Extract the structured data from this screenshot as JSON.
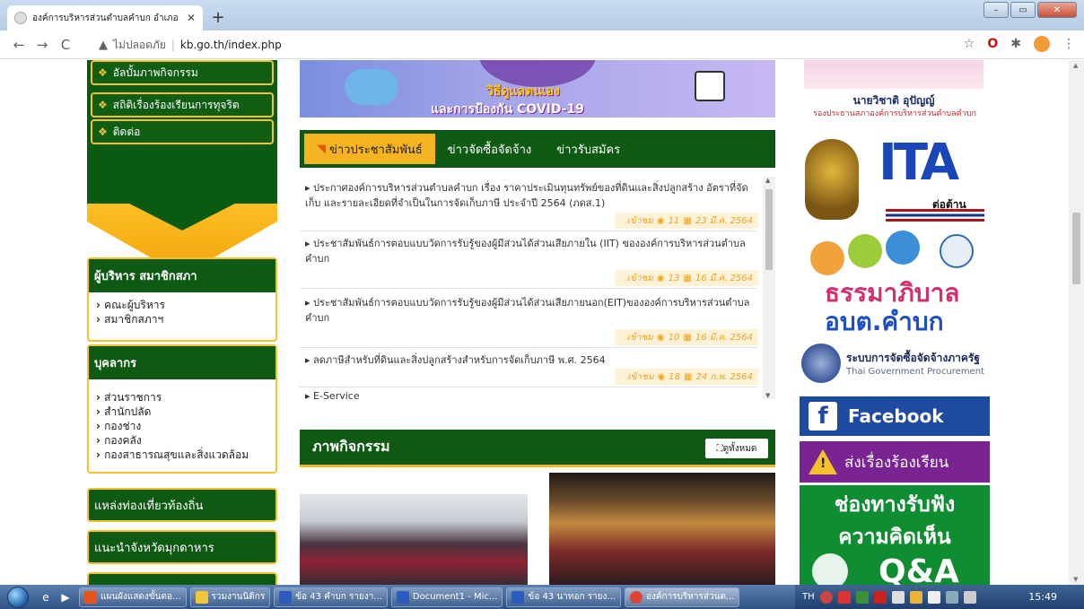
{
  "browser": {
    "tab_title": "องค์การบริหารส่วนตำบลคำบก อำเภอ",
    "window_title": "",
    "insecure_label": "ไม่ปลอดภัย",
    "url": "kb.go.th/index.php"
  },
  "left_menu": [
    {
      "label": "อัลบั้มภาพกิจกรรม"
    },
    {
      "label": "สถิติเรื่องร้องเรียนการทุจริต"
    },
    {
      "label": "ติดต่อ"
    }
  ],
  "executives": {
    "title": "ผู้บริหาร สมาชิกสภา",
    "items": [
      "คณะผู้บริหาร",
      "สมาชิกสภาฯ"
    ]
  },
  "personnel": {
    "title": "บุคลากร",
    "items": [
      "ส่วนราชการ",
      "สำนักปลัด",
      "กองช่าง",
      "กองคลัง",
      "กองสาธารณสุขและสิ่งแวดล้อม"
    ]
  },
  "side_buttons": [
    {
      "label": "แหล่งท่องเที่ยวท้องถิ่น"
    },
    {
      "label": "แนะนำจังหวัดมุกดาหาร"
    }
  ],
  "banner": {
    "title": "วิธีดูแลตนเอง",
    "subtitle": "และการป้องกัน COVID-19"
  },
  "news": {
    "tabs": [
      "ข่าวประชาสัมพันธ์",
      "ข่าวจัดซื้อจัดจ้าง",
      "ข่าวรับสมัคร"
    ],
    "items": [
      {
        "headline": "ประกาศองค์การบริหารส่วนตำบลคำบก เรื่อง ราคาประเมินทุนทรัพย์ของที่ดินและสิ่งปลูกสร้าง อัตราที่จัดเก็บ และรายละเอียดที่จำเป็นในการจัดเก็บภาษี ประจำปี 2564 (ภดส.1)",
        "views_label": "เข้าชม",
        "views": "11",
        "date": "23 มี.ค. 2564"
      },
      {
        "headline": "ประชาสัมพันธ์การตอบแบบวัดการรับรู้ของผู้มีส่วนได้ส่วนเสียภายใน (IIT) ขององค์การบริหารส่วนตำบลคำบก",
        "views_label": "เข้าชม",
        "views": "13",
        "date": "16 มี.ค. 2564"
      },
      {
        "headline": "ประชาสัมพันธ์การตอบแบบวัดการรับรู้ของผู้มีส่วนได้ส่วนเสียภายนอก(EIT)ขององค์การบริหารส่วนตำบลคำบก",
        "views_label": "เข้าชม",
        "views": "10",
        "date": "16 มี.ค. 2564"
      },
      {
        "headline": "ลดภาษีสำหรับที่ดินและสิ่งปลูกสร้างสำหรับการจัดเก็บภาษี พ.ศ. 2564",
        "views_label": "เข้าชม",
        "views": "18",
        "date": "24 ก.พ. 2564"
      },
      {
        "headline": "E-Service",
        "views_label": "",
        "views": "",
        "date": ""
      }
    ]
  },
  "activity": {
    "title": "ภาพกิจกรรม",
    "view_all": "ดูทั้งหมด"
  },
  "right_col": {
    "official_name": "นายวิชาติ อุปัญญ์",
    "official_role": "รองประธานสภาองค์การบริหารส่วนตำบลคำบก",
    "ita_text": "ITA",
    "ita_sub": "ต่อต้าน",
    "good_gov_1": "ธรรมาภิบาล",
    "good_gov_2": "อบต.คำบก",
    "egp_th": "ระบบการจัดซื้อจัดจ้างภาครัฐ",
    "egp_en": "Thai Government Procurement",
    "facebook": "Facebook",
    "complaint": "ส่งเรื่องร้องเรียน",
    "feedback_1": "ช่องทางรับฟัง",
    "feedback_2": "ความคิดเห็น",
    "qa": "Q&A"
  },
  "taskbar": {
    "buttons": [
      {
        "label": "แผนผังแสดงขั้นตอ...",
        "icon_color": "#e8541c"
      },
      {
        "label": "รวมงานนิติกร",
        "icon_color": "#f3c33a"
      },
      {
        "label": "ข้อ 43 คำบก รายงา...",
        "icon_color": "#2a5bbd"
      },
      {
        "label": "Document1 - Mic...",
        "icon_color": "#2a5bbd"
      },
      {
        "label": "ข้อ 43 นาทอก รายง...",
        "icon_color": "#2a5bbd"
      },
      {
        "label": "องค์การบริหารส่วนต...",
        "icon_color": "#db4437"
      }
    ],
    "lang": "TH",
    "clock": "15:49"
  }
}
